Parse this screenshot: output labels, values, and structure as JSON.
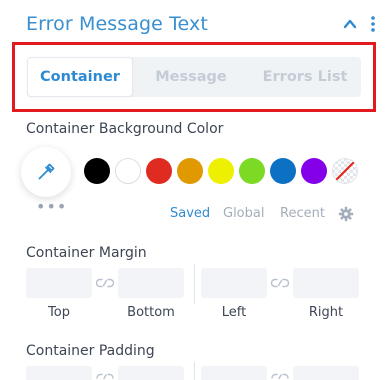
{
  "panel": {
    "title": "Error Message Text",
    "collapse_icon": "chevron-up-icon",
    "more_icon": "vertical-dots-icon"
  },
  "tabs": [
    {
      "label": "Container",
      "active": true
    },
    {
      "label": "Message",
      "active": false
    },
    {
      "label": "Errors List",
      "active": false
    }
  ],
  "highlight_color": "#e11a20",
  "accent_color": "#2e8bd2",
  "background_color": {
    "label": "Container Background Color",
    "picker_icon": "eyedropper-icon",
    "more_label": "•••",
    "swatches": [
      "#000000",
      "#ffffff",
      "#e02b20",
      "#e09900",
      "#edf000",
      "#7cda24",
      "#0c71c3",
      "#8300e9",
      "none"
    ],
    "footer_tabs": [
      {
        "label": "Saved",
        "active": true
      },
      {
        "label": "Global",
        "active": false
      },
      {
        "label": "Recent",
        "active": false
      }
    ],
    "settings_icon": "gear-icon"
  },
  "margin": {
    "label": "Container Margin",
    "fields": [
      "Top",
      "Bottom",
      "Left",
      "Right"
    ],
    "link_icon": "link-icon"
  },
  "padding": {
    "label": "Container Padding"
  }
}
